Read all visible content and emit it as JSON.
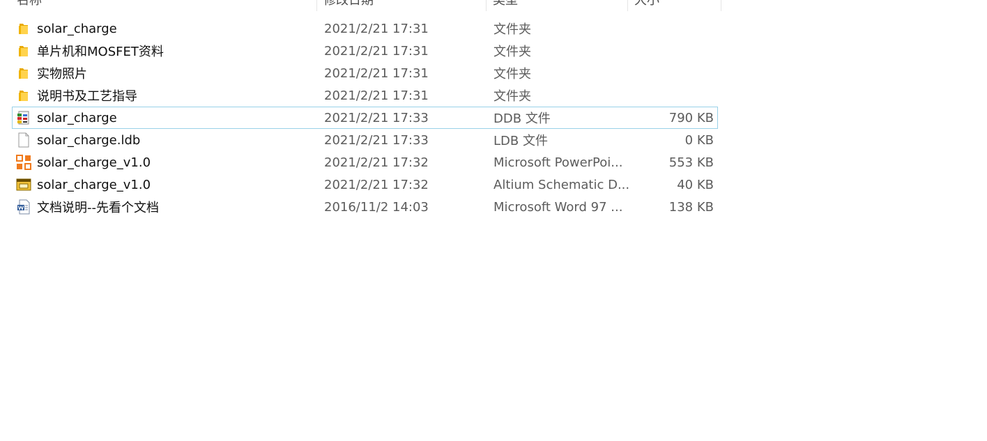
{
  "header": {
    "name": "名称",
    "date": "修改日期",
    "type": "类型",
    "size": "大小"
  },
  "files": [
    {
      "icon": "folder-icon",
      "name": "solar_charge",
      "date": "2021/2/21 17:31",
      "type": "文件夹",
      "size": ""
    },
    {
      "icon": "folder-icon",
      "name": "单片机和MOSFET资料",
      "date": "2021/2/21 17:31",
      "type": "文件夹",
      "size": ""
    },
    {
      "icon": "folder-icon",
      "name": "实物照片",
      "date": "2021/2/21 17:31",
      "type": "文件夹",
      "size": ""
    },
    {
      "icon": "folder-icon",
      "name": "说明书及工艺指导",
      "date": "2021/2/21 17:31",
      "type": "文件夹",
      "size": ""
    },
    {
      "icon": "ddb-file-icon",
      "name": "solar_charge",
      "date": "2021/2/21 17:33",
      "type": "DDB 文件",
      "size": "790 KB"
    },
    {
      "icon": "blank-file-icon",
      "name": "solar_charge.ldb",
      "date": "2021/2/21 17:33",
      "type": "LDB 文件",
      "size": "0 KB"
    },
    {
      "icon": "powerpoint-file-icon",
      "name": "solar_charge_v1.0",
      "date": "2021/2/21 17:32",
      "type": "Microsoft PowerPoi...",
      "size": "553 KB"
    },
    {
      "icon": "schematic-file-icon",
      "name": "solar_charge_v1.0",
      "date": "2021/2/21 17:32",
      "type": "Altium Schematic D...",
      "size": "40 KB"
    },
    {
      "icon": "word-file-icon",
      "name": "文档说明--先看个文档",
      "date": "2016/11/2 14:03",
      "type": "Microsoft Word 97 ...",
      "size": "138 KB"
    }
  ]
}
